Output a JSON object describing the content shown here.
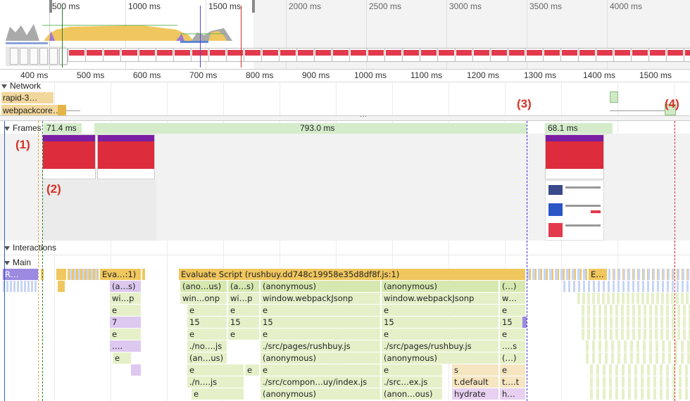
{
  "overview": {
    "ticks": [
      "500 ms",
      "1000 ms",
      "1500 ms",
      "2000 ms",
      "2500 ms",
      "3000 ms",
      "3500 ms",
      "4000 ms"
    ]
  },
  "ruler": {
    "ticks": [
      "400 ms",
      "500 ms",
      "600 ms",
      "700 ms",
      "800 ms",
      "900 ms",
      "1000 ms",
      "1100 ms",
      "1200 ms",
      "1300 ms",
      "1400 ms",
      "1500 ms"
    ]
  },
  "network": {
    "label": "Network",
    "requests": [
      "rapid-3…",
      "webpackcore…"
    ]
  },
  "annotations": [
    "(1)",
    "(2)",
    "(3)",
    "(4)"
  ],
  "frames": {
    "label": "Frames",
    "durations": [
      "71.4 ms",
      "793.0 ms",
      "68.1 ms"
    ]
  },
  "interactions": {
    "label": "Interactions"
  },
  "main": {
    "label": "Main",
    "r0": [
      "R…",
      "Eva…:1)",
      "Evaluate Script (rushbuy.dd748c19958e35d8df8f.js:1)",
      "E…"
    ],
    "r1": [
      "(a…s)",
      "(ano…us)",
      "(a…s)",
      "(anonymous)",
      "(anonymous)",
      "(…)"
    ],
    "r2": [
      "wi…p",
      "win…onp",
      "wi…p",
      "window.webpackJsonp",
      "window.webpackJsonp",
      "w…"
    ],
    "r3": [
      "e",
      "e",
      "e",
      "e",
      "e",
      "e"
    ],
    "r4": [
      "7",
      "15",
      "15",
      "15",
      "15",
      "15"
    ],
    "r5": [
      "e",
      "e",
      "e",
      "e",
      "e",
      "e"
    ],
    "r6": [
      "….",
      "./no….js",
      "./src/pages/rushbuy.js",
      "./src/pages/rushbuy.js",
      "….s"
    ],
    "r7": [
      "e",
      "(an…us)",
      "(anonymous)",
      "(anonymous)",
      "(…)"
    ],
    "r8": [
      "e",
      "e",
      "e",
      "e",
      "s",
      "e"
    ],
    "r9": [
      "./n….js",
      "./src/compon…uy/index.js",
      "./src…ex.js",
      "t.default",
      "t….t"
    ],
    "r10": [
      "e",
      "(anonymous)",
      "(anon…ous)",
      "hydrate",
      "h…"
    ]
  }
}
